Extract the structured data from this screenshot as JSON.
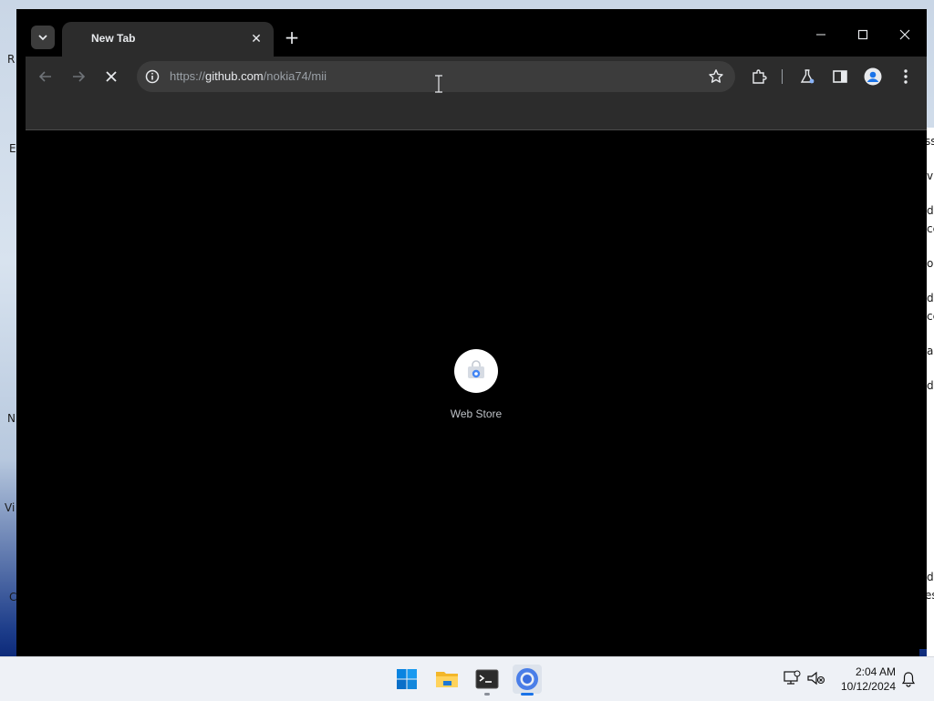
{
  "browser": {
    "tab": {
      "title": "New Tab",
      "close_glyph": "✕"
    },
    "new_tab_glyph": "+",
    "window_controls": {
      "minimize": "—",
      "maximize": "☐",
      "close": "✕"
    },
    "address": {
      "scheme": "https://",
      "host": "github.com",
      "path": "/nokia74/mii"
    },
    "shortcut": {
      "label": "Web Store",
      "icon": "web-store-icon"
    },
    "accent": "#8ab4f8"
  },
  "desktop_fragments": {
    "left": [
      "R",
      "E",
      "N",
      "Vi",
      "C"
    ],
    "right": [
      "ss",
      "vi",
      "d",
      "cc",
      "o",
      "d",
      "cc",
      "a",
      "d",
      "d",
      "es"
    ]
  },
  "taskbar": {
    "apps": [
      "start-icon",
      "file-explorer-icon",
      "terminal-icon",
      "chrome-icon"
    ],
    "time": "2:04 AM",
    "date": "10/12/2024"
  }
}
